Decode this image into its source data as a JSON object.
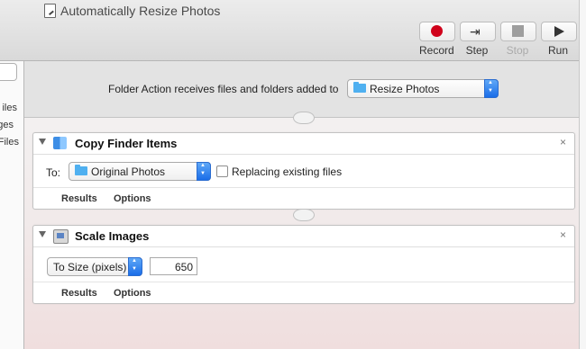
{
  "window": {
    "title": "Automatically Resize Photos",
    "icon": "script-document-icon"
  },
  "toolbar": {
    "buttons": [
      {
        "label": "Record",
        "icon": "record-icon",
        "enabled": true
      },
      {
        "label": "Step",
        "icon": "step-icon",
        "enabled": true
      },
      {
        "label": "Stop",
        "icon": "stop-icon",
        "enabled": false
      },
      {
        "label": "Run",
        "icon": "play-icon",
        "enabled": true
      }
    ]
  },
  "library": {
    "items": [
      "iles",
      "ges",
      "Files"
    ]
  },
  "workflow": {
    "receives_label": "Folder Action receives files and folders added to",
    "folder_value": "Resize Photos"
  },
  "actions": [
    {
      "title": "Copy Finder Items",
      "icon": "finder-icon",
      "to_label": "To:",
      "to_value": "Original Photos",
      "checkbox_label": "Replacing existing files",
      "checkbox_checked": false,
      "results_label": "Results",
      "options_label": "Options",
      "close": "×"
    },
    {
      "title": "Scale Images",
      "icon": "preview-icon",
      "scale_mode": "To Size (pixels)",
      "size_value": "650",
      "results_label": "Results",
      "options_label": "Options",
      "close": "×"
    }
  ],
  "colors": {
    "record": "#d0021b",
    "stepper": "#1a6de8",
    "folder": "#4fb0f0"
  }
}
